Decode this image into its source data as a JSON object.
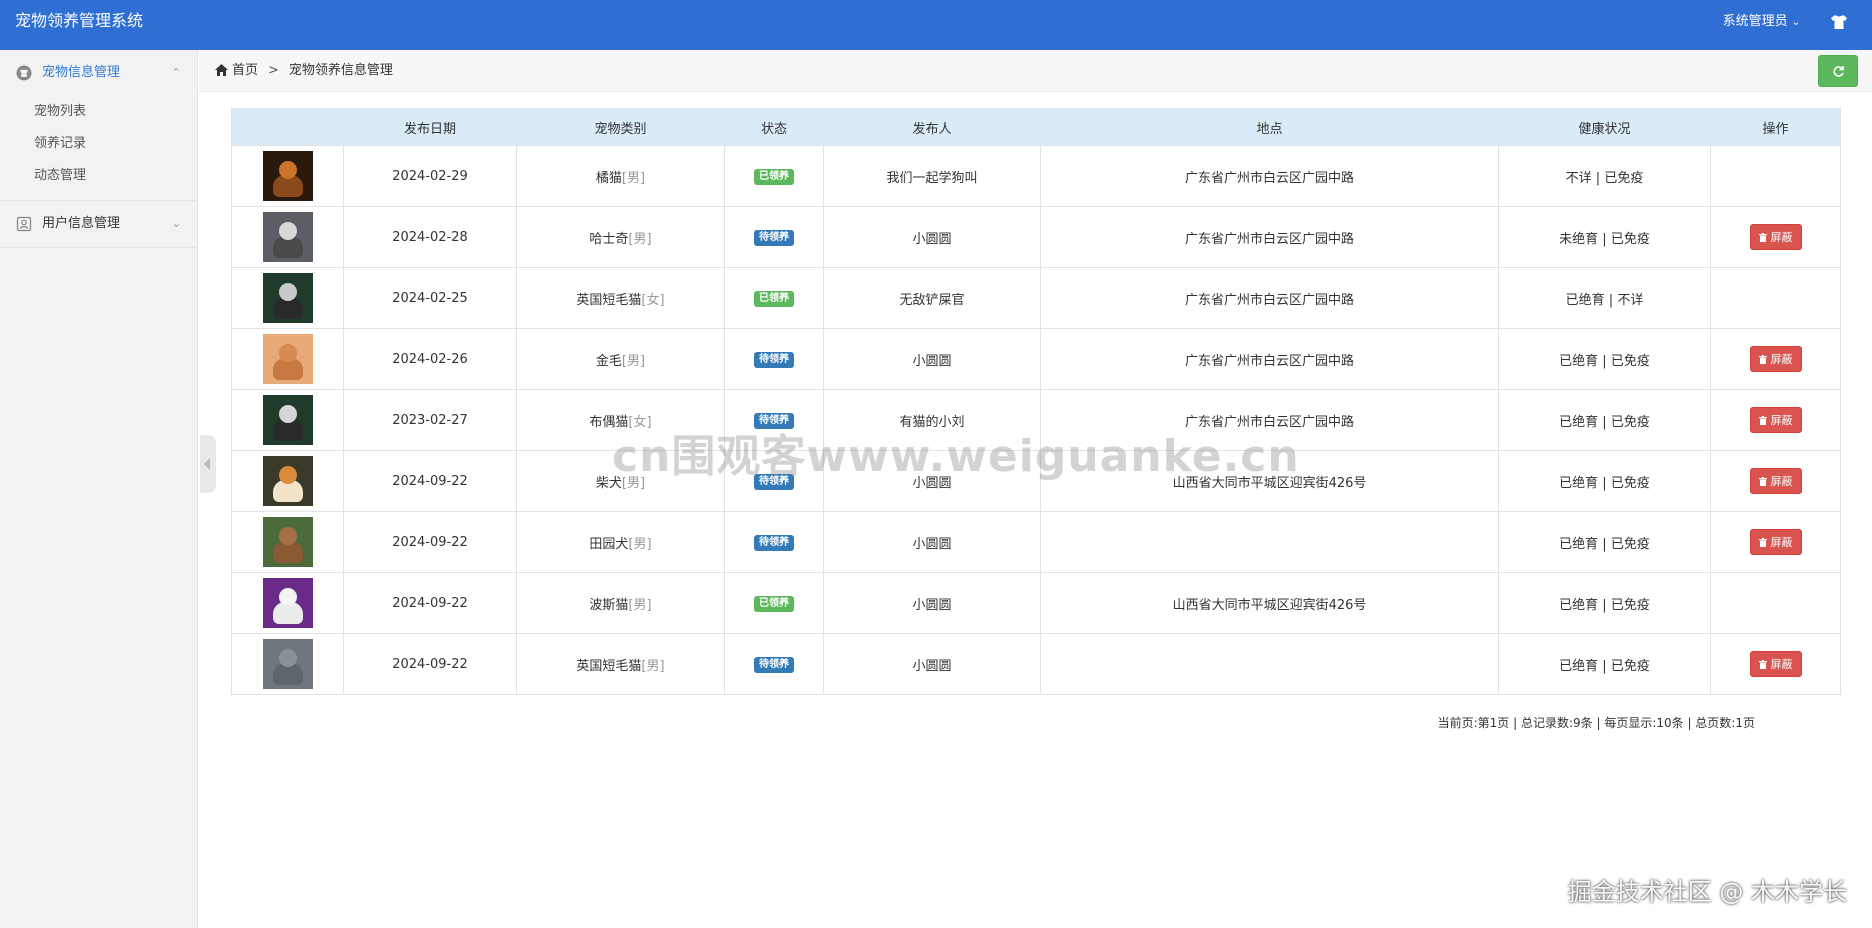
{
  "app": {
    "title": "宠物领养管理系统",
    "user": "系统管理员"
  },
  "sidebar": {
    "groups": [
      {
        "label": "宠物信息管理",
        "items": [
          "宠物列表",
          "领养记录",
          "动态管理"
        ]
      },
      {
        "label": "用户信息管理"
      }
    ]
  },
  "breadcrumb": {
    "home": "首页",
    "sep": ">",
    "current": "宠物领养信息管理"
  },
  "table": {
    "headers": [
      "",
      "发布日期",
      "宠物类别",
      "状态",
      "发布人",
      "地点",
      "健康状况",
      "操作"
    ],
    "rows": [
      {
        "date": "2024-02-29",
        "type": "橘猫",
        "gender": "[男]",
        "status": "已领养",
        "publisher": "我们一起学狗叫",
        "location": "广东省广州市白云区广园中路",
        "health": "不详 | 已免疫",
        "action": ""
      },
      {
        "date": "2024-02-28",
        "type": "哈士奇",
        "gender": "[男]",
        "status": "待领养",
        "publisher": "小圆圆",
        "location": "广东省广州市白云区广园中路",
        "health": "未绝育 | 已免疫",
        "action": "屏蔽"
      },
      {
        "date": "2024-02-25",
        "type": "英国短毛猫",
        "gender": "[女]",
        "status": "已领养",
        "publisher": "无敌铲屎官",
        "location": "广东省广州市白云区广园中路",
        "health": "已绝育 | 不详",
        "action": ""
      },
      {
        "date": "2024-02-26",
        "type": "金毛",
        "gender": "[男]",
        "status": "待领养",
        "publisher": "小圆圆",
        "location": "广东省广州市白云区广园中路",
        "health": "已绝育 | 已免疫",
        "action": "屏蔽"
      },
      {
        "date": "2023-02-27",
        "type": "布偶猫",
        "gender": "[女]",
        "status": "待领养",
        "publisher": "有猫的小刘",
        "location": "广东省广州市白云区广园中路",
        "health": "已绝育 | 已免疫",
        "action": "屏蔽"
      },
      {
        "date": "2024-09-22",
        "type": "柴犬",
        "gender": "[男]",
        "status": "待领养",
        "publisher": "小圆圆",
        "location": "山西省大同市平城区迎宾街426号",
        "health": "已绝育 | 已免疫",
        "action": "屏蔽"
      },
      {
        "date": "2024-09-22",
        "type": "田园犬",
        "gender": "[男]",
        "status": "待领养",
        "publisher": "小圆圆",
        "location": "",
        "health": "已绝育 | 已免疫",
        "action": "屏蔽"
      },
      {
        "date": "2024-09-22",
        "type": "波斯猫",
        "gender": "[男]",
        "status": "已领养",
        "publisher": "小圆圆",
        "location": "山西省大同市平城区迎宾街426号",
        "health": "已绝育 | 已免疫",
        "action": ""
      },
      {
        "date": "2024-09-22",
        "type": "英国短毛猫",
        "gender": "[男]",
        "status": "待领养",
        "publisher": "小圆圆",
        "location": "",
        "health": "已绝育 | 已免疫",
        "action": "屏蔽"
      }
    ]
  },
  "pager": {
    "text": "当前页:第1页 | 总记录数:9条 | 每页显示:10条 | 总页数:1页"
  },
  "watermark": "cn围观客www.weiguanke.cn",
  "corner_watermark": "掘金技术社区 @ 木木学长",
  "colors": {
    "header": "#2f6fd3",
    "done": "#5cb85c",
    "wait": "#337ab7",
    "danger": "#d9534f"
  }
}
